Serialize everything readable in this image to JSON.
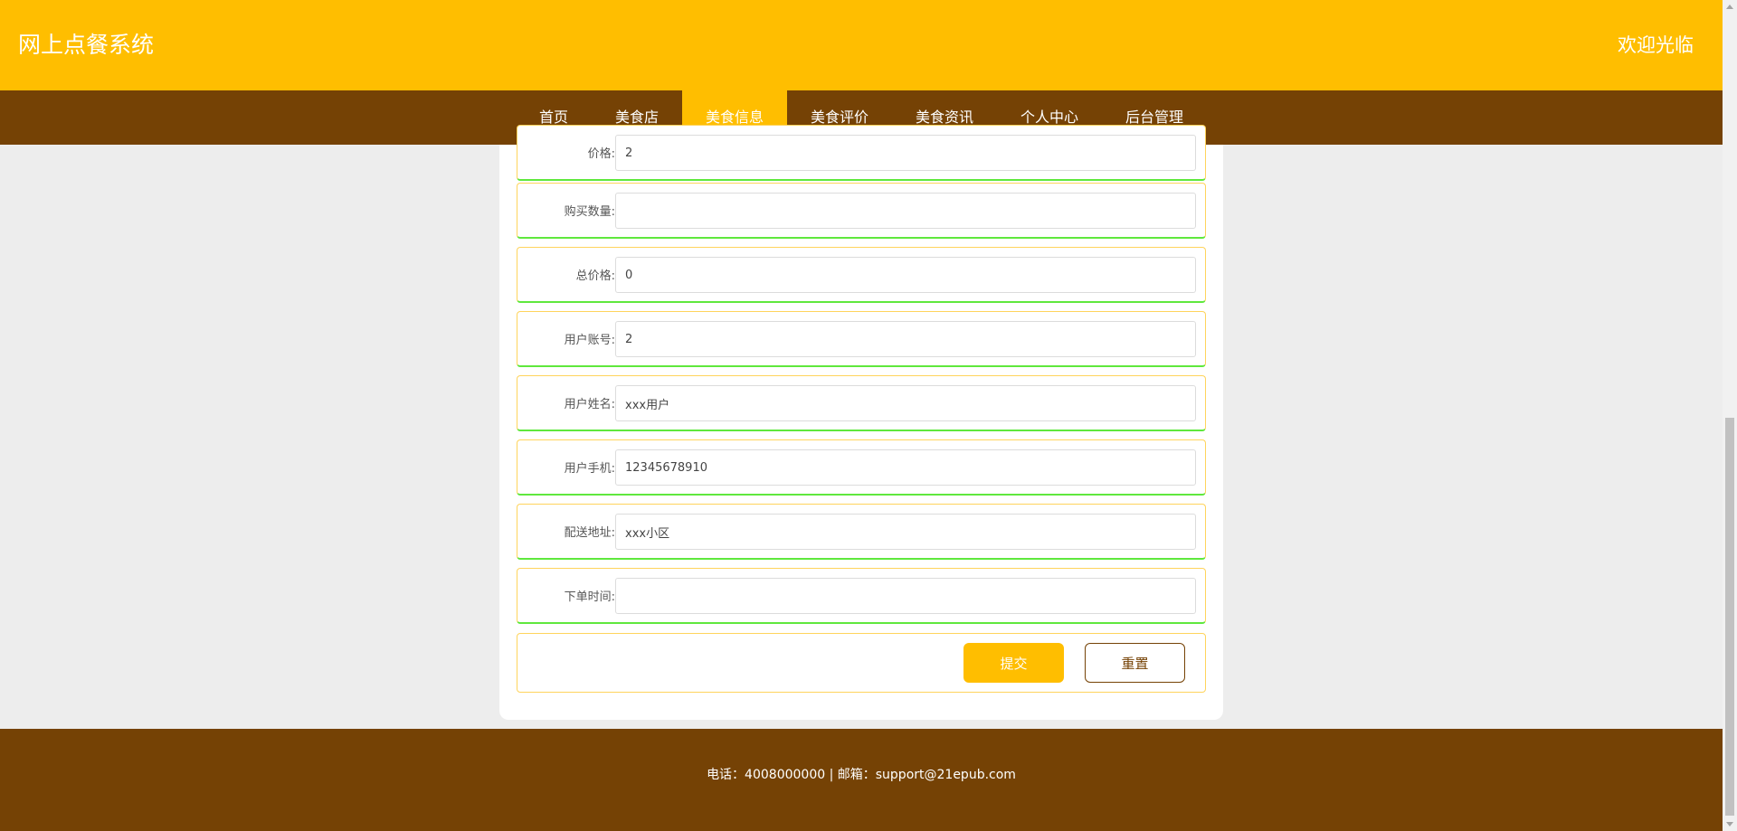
{
  "header": {
    "site_title": "网上点餐系统",
    "welcome": "欢迎光临"
  },
  "nav": {
    "items": [
      {
        "label": "首页"
      },
      {
        "label": "美食店"
      },
      {
        "label": "美食信息",
        "active": true
      },
      {
        "label": "美食评价"
      },
      {
        "label": "美食资讯"
      },
      {
        "label": "个人中心"
      },
      {
        "label": "后台管理"
      }
    ]
  },
  "form": {
    "rows": [
      {
        "label": "价格:",
        "value": "2"
      },
      {
        "label": "购买数量:",
        "value": ""
      },
      {
        "label": "总价格:",
        "value": "0"
      },
      {
        "label": "用户账号:",
        "value": "2"
      },
      {
        "label": "用户姓名:",
        "value": "xxx用户"
      },
      {
        "label": "用户手机:",
        "value": "12345678910"
      },
      {
        "label": "配送地址:",
        "value": "xxx小区"
      },
      {
        "label": "下单时间:",
        "value": ""
      }
    ],
    "submit_label": "提交",
    "reset_label": "重置"
  },
  "footer": {
    "text": "电话：4008000000 | 邮箱：support@21epub.com"
  },
  "colors": {
    "primary_yellow": "#ffbe00",
    "brown": "#754205",
    "row_border": "#ffd45c",
    "row_accent_green": "#5fe83d"
  }
}
